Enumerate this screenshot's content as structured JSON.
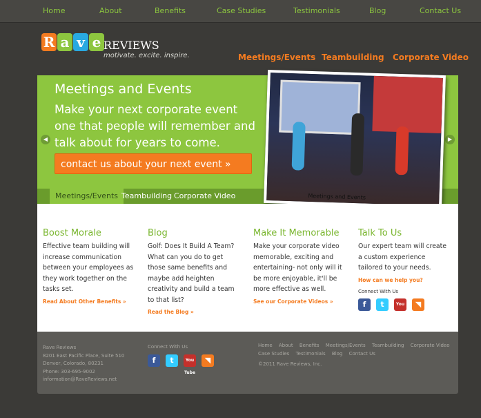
{
  "topnav": [
    "Home",
    "About",
    "Benefits",
    "Case Studies",
    "Testimonials",
    "Blog",
    "Contact Us"
  ],
  "logo": {
    "letters": [
      "R",
      "a",
      "v",
      "e"
    ],
    "letter_colors": [
      "#f47b20",
      "#8dc63f",
      "#29a9e1",
      "#8dc63f"
    ],
    "brand": "REVIEWS",
    "tagline": "motivate. excite. inspire."
  },
  "mainnav": [
    "Meetings/Events",
    "Teambuilding",
    "Corporate Video"
  ],
  "hero": {
    "heading": "Meetings and Events",
    "subheading": "Make your next corporate event one that people will remember and talk about for years to come.",
    "cta": "contact us about your next event »",
    "tabs": [
      "Meetings/Events",
      "Teambuilding",
      "Corporate Video"
    ],
    "photo_caption": "Meetings and Events"
  },
  "columns": [
    {
      "title": "Boost Morale",
      "text": "Effective team building will increase communication between your employees as they work together on the tasks set.",
      "link": "Read About Other Benefits »"
    },
    {
      "title": "Blog",
      "text": "Golf: Does It Build A Team? What can you do to get those same benefits and maybe add heighten creativity and build a team to that list?",
      "link": "Read the Blog »"
    },
    {
      "title": "Make It Memorable",
      "text": "Make your corporate video memorable, exciting and entertaining- not only will it be more enjoyable, it'll be more effective as well.",
      "link": "See our Corporate Videos »"
    },
    {
      "title": "Talk To Us",
      "text": "Our expert team will create a custom experience tailored to your needs.",
      "link": "How can we help you?",
      "connect": "Connect With Us"
    }
  ],
  "social": {
    "fb": "f",
    "tw": "t",
    "yt": "You Tube",
    "rss": "◥"
  },
  "footer": {
    "address": [
      "Rave Reviews",
      "8201 East Pacific Place, Suite 510",
      "Denver, Colorado, 80231",
      "Phone: 303-695-9002",
      "information@RaveReviews.net"
    ],
    "connect": "Connect With Us",
    "links": [
      "Home",
      "About",
      "Benefits",
      "Meetings/Events",
      "Teambuilding",
      "Corporate Video",
      "Case Studies",
      "Testimonials",
      "Blog",
      "Contact Us"
    ],
    "copyright": "©2011 Rave Reviews, Inc."
  }
}
